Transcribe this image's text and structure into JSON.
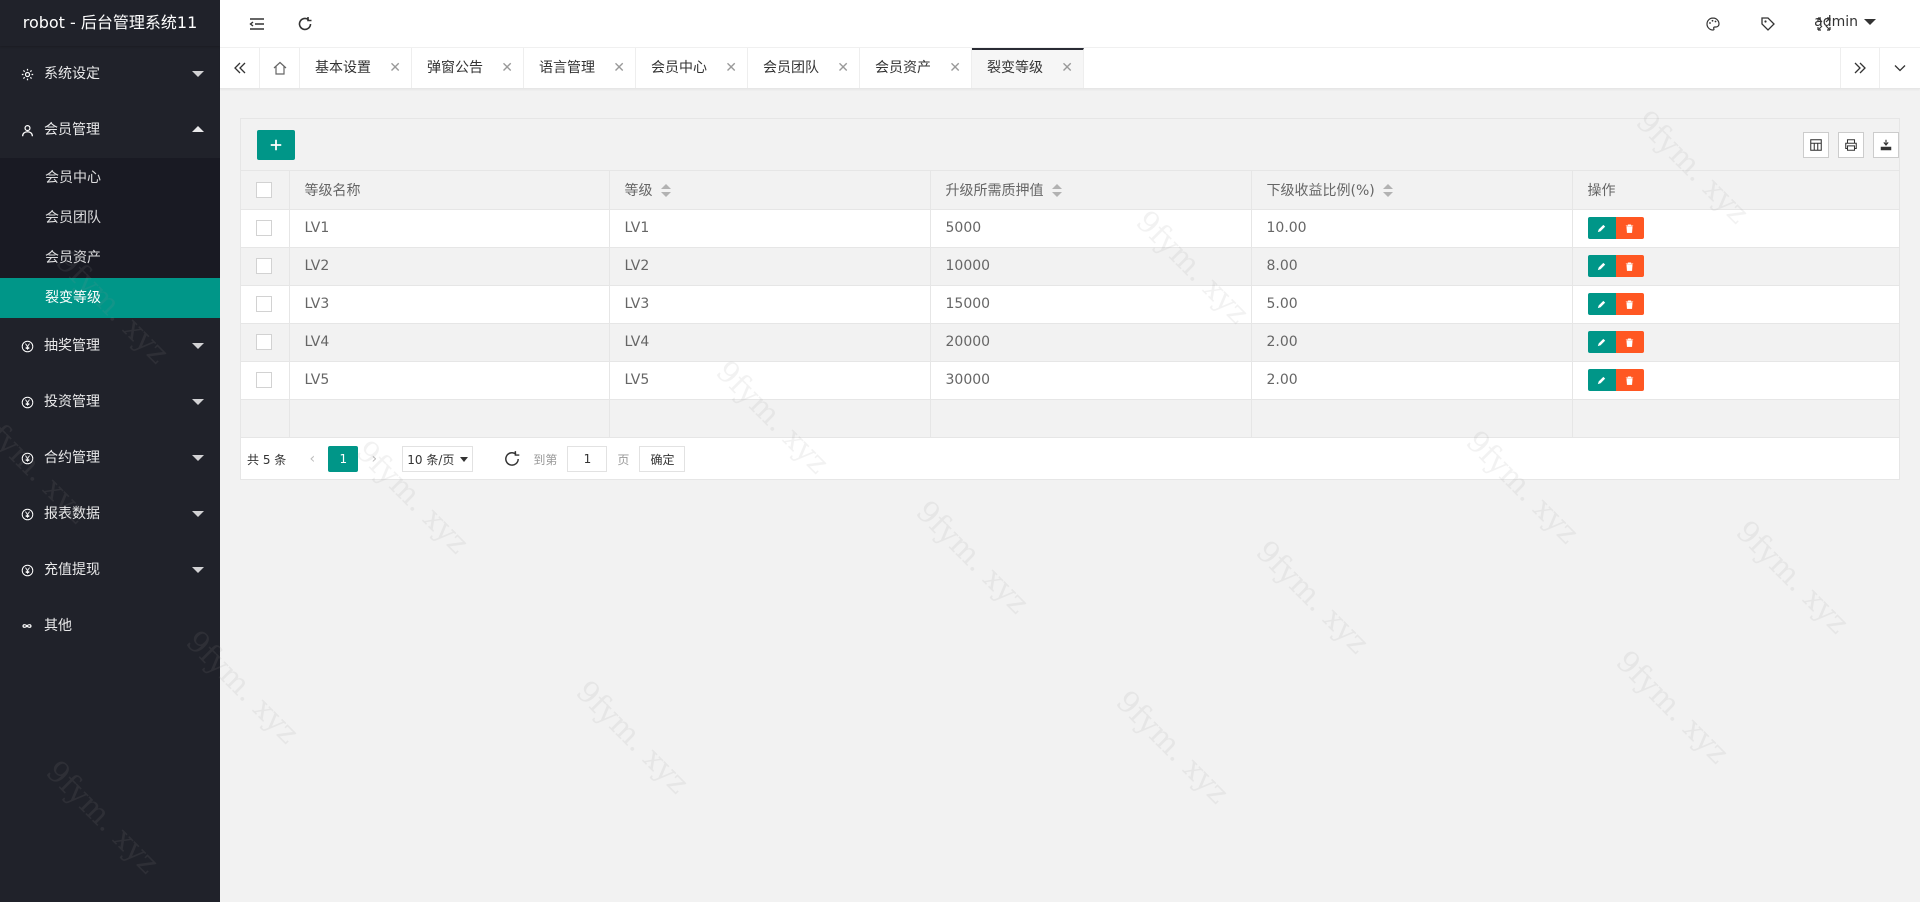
{
  "app": {
    "title": "robot - 后台管理系统11"
  },
  "sidebar": {
    "menus": [
      {
        "label": "系统设定",
        "icon": "gear-icon"
      },
      {
        "label": "会员管理",
        "icon": "user-icon",
        "expanded": true,
        "children": [
          "会员中心",
          "会员团队",
          "会员资产",
          "裂变等级"
        ],
        "active_child": "裂变等级"
      },
      {
        "label": "抽奖管理",
        "icon": "yen-icon"
      },
      {
        "label": "投资管理",
        "icon": "yen-icon"
      },
      {
        "label": "合约管理",
        "icon": "yen-icon"
      },
      {
        "label": "报表数据",
        "icon": "yen-icon"
      },
      {
        "label": "充值提现",
        "icon": "yen-icon"
      },
      {
        "label": "其他",
        "icon": "infinity-icon"
      }
    ]
  },
  "header": {
    "user": "admin"
  },
  "tabs": {
    "items": [
      "基本设置",
      "弹窗公告",
      "语言管理",
      "会员中心",
      "会员团队",
      "会员资产",
      "裂变等级"
    ],
    "active": "裂变等级"
  },
  "table": {
    "columns": [
      "等级名称",
      "等级",
      "升级所需质押值",
      "下级收益比例(%)",
      "操作"
    ],
    "rows": [
      [
        "LV1",
        "LV1",
        "5000",
        "10.00"
      ],
      [
        "LV2",
        "LV2",
        "10000",
        "8.00"
      ],
      [
        "LV3",
        "LV3",
        "15000",
        "5.00"
      ],
      [
        "LV4",
        "LV4",
        "20000",
        "2.00"
      ],
      [
        "LV5",
        "LV5",
        "30000",
        "2.00"
      ]
    ]
  },
  "pager": {
    "total": "共 5 条",
    "current": "1",
    "size": "10 条/页",
    "goto_label": "到第",
    "goto_value": "1",
    "page_label": "页",
    "confirm": "确定"
  },
  "colors": {
    "sidebar_bg": "#20222a",
    "accent": "#009688",
    "danger": "#ff5722"
  },
  "watermark": "9fym. xyz"
}
